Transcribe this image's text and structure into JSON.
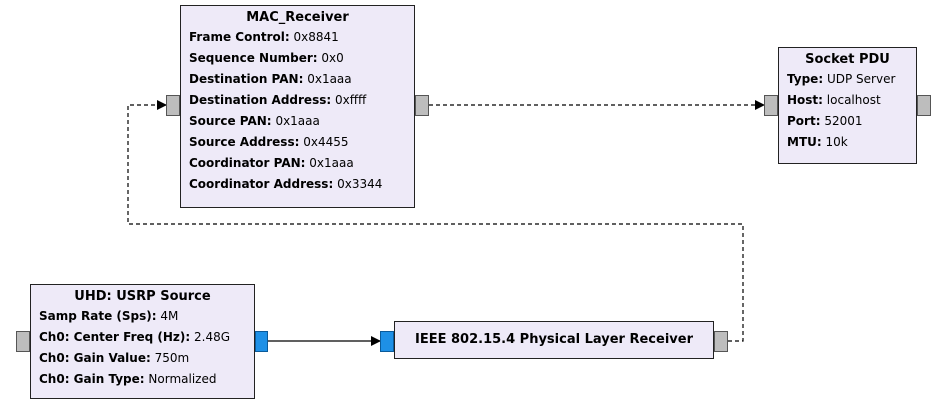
{
  "blocks": {
    "mac_receiver": {
      "title": "MAC_Receiver",
      "params": [
        {
          "key": "Frame Control:",
          "value": "0x8841"
        },
        {
          "key": "Sequence Number:",
          "value": "0x0"
        },
        {
          "key": "Destination PAN:",
          "value": "0x1aaa"
        },
        {
          "key": "Destination Address:",
          "value": "0xffff"
        },
        {
          "key": "Source PAN:",
          "value": "0x1aaa"
        },
        {
          "key": "Source Address:",
          "value": "0x4455"
        },
        {
          "key": "Coordinator PAN:",
          "value": "0x1aaa"
        },
        {
          "key": "Coordinator Address:",
          "value": "0x3344"
        }
      ]
    },
    "socket_pdu": {
      "title": "Socket PDU",
      "params": [
        {
          "key": "Type:",
          "value": "UDP Server"
        },
        {
          "key": "Host:",
          "value": "localhost"
        },
        {
          "key": "Port:",
          "value": "52001"
        },
        {
          "key": "MTU:",
          "value": "10k"
        }
      ]
    },
    "usrp_source": {
      "title": "UHD: USRP Source",
      "params": [
        {
          "key": "Samp Rate (Sps):",
          "value": "4M"
        },
        {
          "key": "Ch0: Center Freq (Hz):",
          "value": "2.48G"
        },
        {
          "key": "Ch0: Gain Value:",
          "value": "750m"
        },
        {
          "key": "Ch0: Gain Type:",
          "value": "Normalized"
        }
      ]
    },
    "phy_receiver": {
      "title": "IEEE 802.15.4 Physical Layer Receiver"
    }
  },
  "colors": {
    "block_fill": "#eeeaf8",
    "message_port": "#bdbdbd",
    "stream_port": "#1e90e6",
    "connection": "#000000"
  }
}
